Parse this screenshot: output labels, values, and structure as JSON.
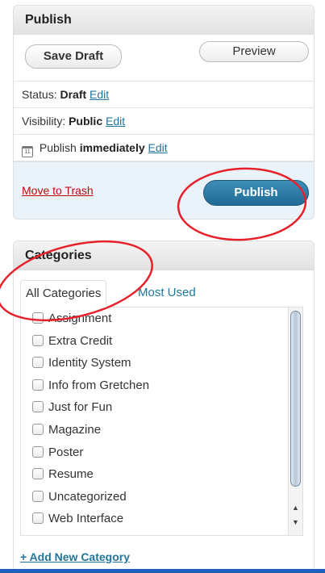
{
  "publish": {
    "title": "Publish",
    "save_draft_label": "Save Draft",
    "preview_label": "Preview",
    "status_label": "Status:",
    "status_value": "Draft",
    "visibility_label": "Visibility:",
    "visibility_value": "Public",
    "schedule_prefix": "Publish",
    "schedule_value": "immediately",
    "calendar_day": "11",
    "edit_label": "Edit",
    "trash_label": "Move to Trash",
    "publish_button_label": "Publish"
  },
  "categories": {
    "title": "Categories",
    "tabs": [
      "All Categories",
      "Most Used"
    ],
    "items": [
      "Assignment",
      "Extra Credit",
      "Identity System",
      "Info from Gretchen",
      "Just for Fun",
      "Magazine",
      "Poster",
      "Resume",
      "Uncategorized",
      "Web Interface"
    ],
    "add_new_label": "+ Add New Category"
  },
  "icons": {
    "calendar": "calendar-icon",
    "scroll_up": "scroll-up-arrow-icon",
    "scroll_down": "scroll-down-arrow-icon"
  },
  "colors": {
    "link": "#21759b",
    "trash": "#bc0b0b",
    "publish_button": "#2a7aa8",
    "annotation": "#e8202a",
    "major_actions_bg": "#eaf2fa"
  }
}
